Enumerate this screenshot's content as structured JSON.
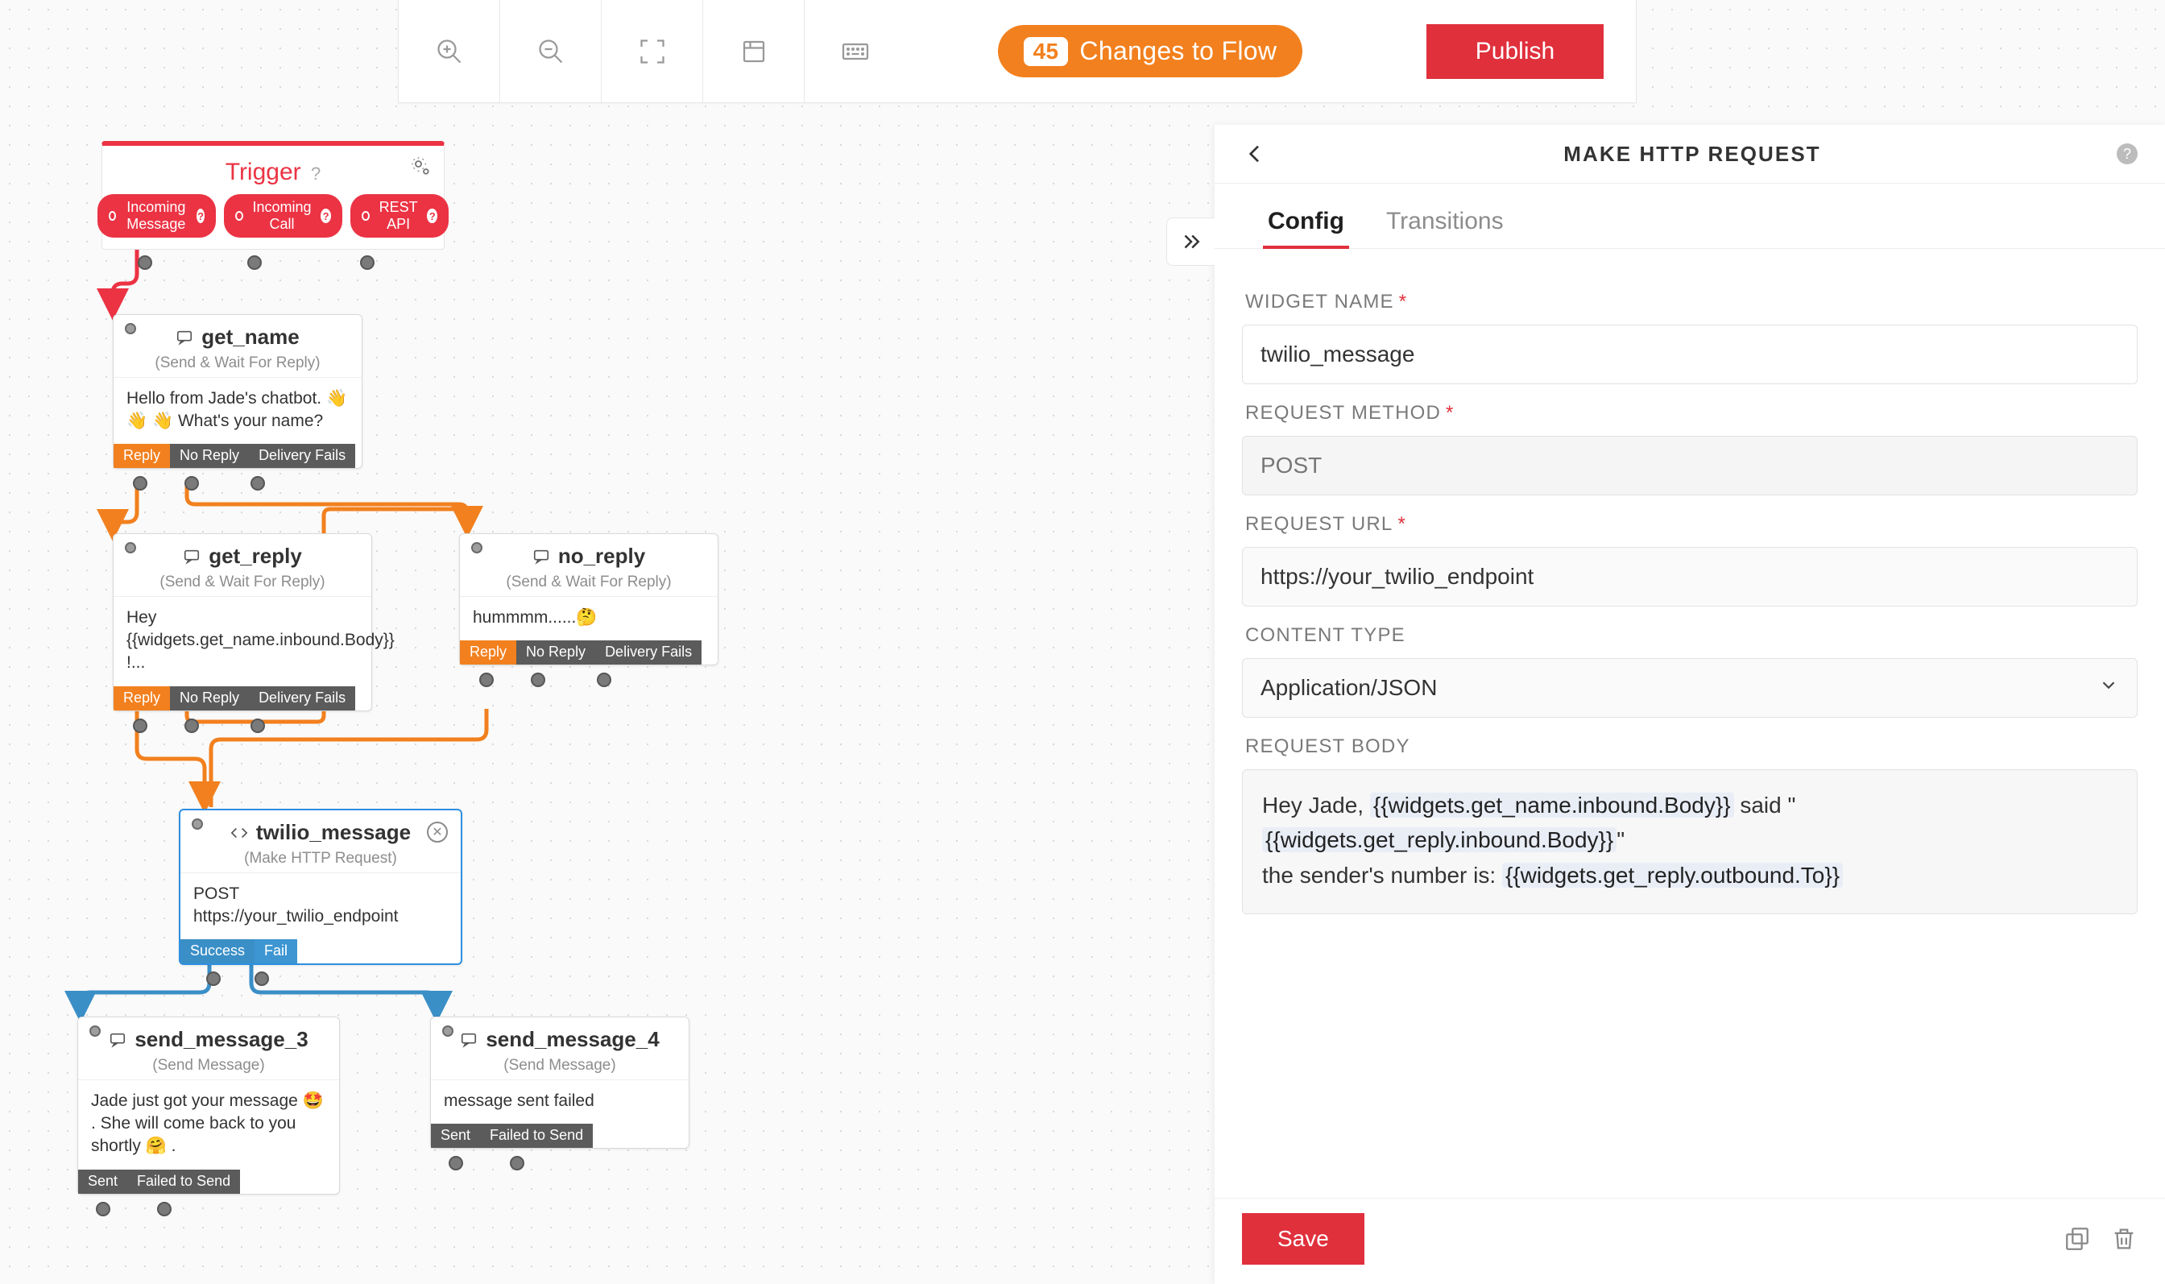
{
  "toolbar": {
    "changes_count": "45",
    "changes_label": "Changes to Flow",
    "publish_label": "Publish"
  },
  "trigger": {
    "title": "Trigger",
    "pills": [
      "Incoming Message",
      "Incoming Call",
      "REST API"
    ]
  },
  "nodes": {
    "get_name": {
      "title": "get_name",
      "subtitle": "(Send & Wait For Reply)",
      "body": "Hello from Jade's chatbot. 👋 👋 👋 What's your name?",
      "ports": [
        "Reply",
        "No Reply",
        "Delivery Fails"
      ]
    },
    "get_reply": {
      "title": "get_reply",
      "subtitle": "(Send & Wait For Reply)",
      "body": "Hey {{widgets.get_name.inbound.Body}} !...",
      "ports": [
        "Reply",
        "No Reply",
        "Delivery Fails"
      ]
    },
    "no_reply": {
      "title": "no_reply",
      "subtitle": "(Send & Wait For Reply)",
      "body": "hummmm......🤔",
      "ports": [
        "Reply",
        "No Reply",
        "Delivery Fails"
      ]
    },
    "twilio_message": {
      "title": "twilio_message",
      "subtitle": "(Make HTTP Request)",
      "body": "POST https://your_twilio_endpoint",
      "ports": [
        "Success",
        "Fail"
      ]
    },
    "send_message_3": {
      "title": "send_message_3",
      "subtitle": "(Send Message)",
      "body": "Jade just got your message 🤩 . She will come back to you shortly 🤗 .",
      "ports": [
        "Sent",
        "Failed to Send"
      ]
    },
    "send_message_4": {
      "title": "send_message_4",
      "subtitle": "(Send Message)",
      "body": "message sent failed",
      "ports": [
        "Sent",
        "Failed to Send"
      ]
    }
  },
  "panel": {
    "title": "MAKE HTTP REQUEST",
    "tabs": {
      "config": "Config",
      "transitions": "Transitions"
    },
    "labels": {
      "widget_name": "WIDGET NAME",
      "request_method": "REQUEST METHOD",
      "request_url": "REQUEST URL",
      "content_type": "CONTENT TYPE",
      "request_body": "REQUEST BODY"
    },
    "values": {
      "widget_name": "twilio_message",
      "request_method": "POST",
      "request_url": "https://your_twilio_endpoint",
      "content_type": "Application/JSON",
      "body_pre1": "Hey Jade, ",
      "body_hi1": "{{widgets.get_name.inbound.Body}}",
      "body_post1": " said \"",
      "body_hi2": "{{widgets.get_reply.inbound.Body}}",
      "body_post2": "\"",
      "body_line2a": "the sender's number is: ",
      "body_hi3": "{{widgets.get_reply.outbound.To}}"
    },
    "save_label": "Save"
  }
}
